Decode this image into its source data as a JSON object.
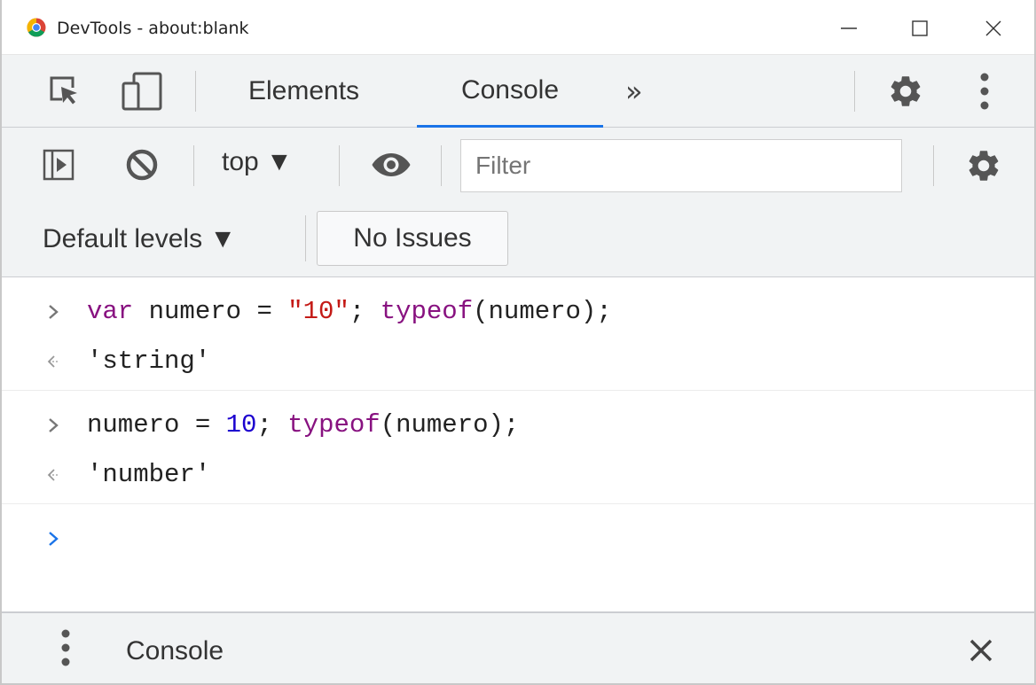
{
  "window": {
    "title": "DevTools - about:blank"
  },
  "tabs": {
    "items": [
      {
        "label": "Elements",
        "active": false
      },
      {
        "label": "Console",
        "active": true
      }
    ],
    "more": "»"
  },
  "toolbar": {
    "context": "top ▼",
    "filter_placeholder": "Filter"
  },
  "levels": {
    "label": "Default levels ▼",
    "issues": "No Issues"
  },
  "console": {
    "entries": [
      {
        "kind": "input",
        "tokens": [
          "var",
          " numero = ",
          "\"10\"",
          "; ",
          "typeof",
          "(numero);"
        ]
      },
      {
        "kind": "output",
        "text": "'string'"
      },
      {
        "kind": "input",
        "tokens": [
          "numero = ",
          "10",
          "; ",
          "typeof",
          "(numero);"
        ]
      },
      {
        "kind": "output",
        "text": "'number'"
      }
    ]
  },
  "drawer": {
    "title": "Console"
  },
  "colors": {
    "accent": "#1a73e8",
    "keyword": "#881280",
    "string": "#c41a16",
    "number": "#1c00cf"
  }
}
